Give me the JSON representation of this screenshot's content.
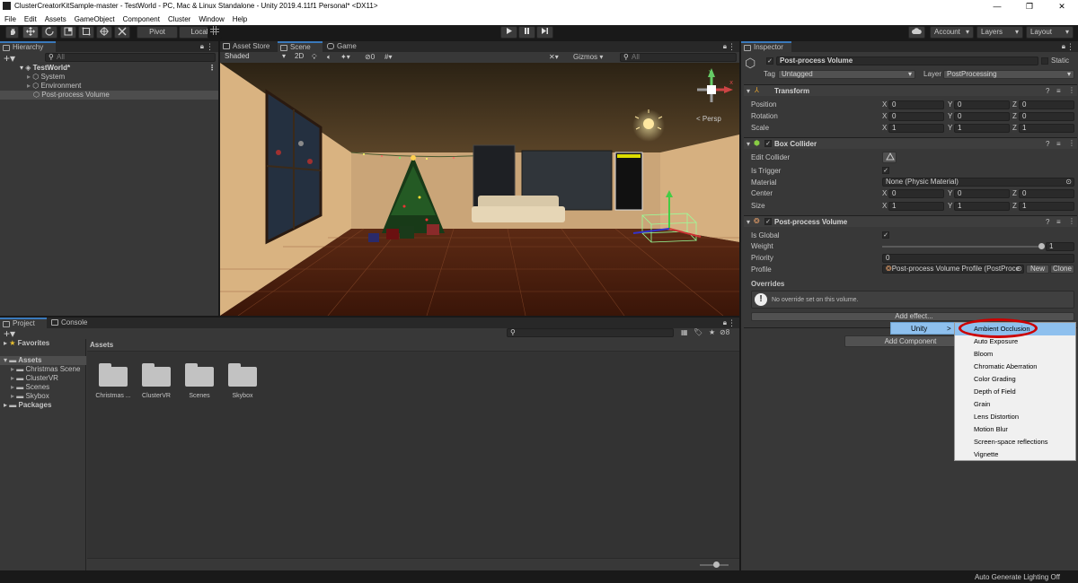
{
  "window": {
    "title": "ClusterCreatorKitSample-master - TestWorld - PC, Mac & Linux Standalone - Unity 2019.4.11f1 Personal* <DX11>",
    "minimize": "—",
    "maximize": "❐",
    "close": "✕"
  },
  "menubar": [
    "File",
    "Edit",
    "Assets",
    "GameObject",
    "Component",
    "Cluster",
    "Window",
    "Help"
  ],
  "toolbar": {
    "pivot": "Pivot",
    "local": "Local",
    "account": "Account",
    "layers": "Layers",
    "layout": "Layout"
  },
  "hierarchy": {
    "tab": "Hierarchy",
    "search_placeholder": "All",
    "scene": "TestWorld*",
    "items": [
      "System",
      "Environment",
      "Post-process Volume"
    ]
  },
  "scene_view": {
    "tabs": [
      "Asset Store",
      "Scene",
      "Game"
    ],
    "shading": "Shaded",
    "mode_2d": "2D",
    "hidden_count": "0",
    "gizmos": "Gizmos",
    "search_placeholder": "All",
    "persp": "< Persp"
  },
  "project": {
    "tabs": [
      "Project",
      "Console"
    ],
    "favorites": "Favorites",
    "assets": "Assets",
    "tree": [
      "Christmas Scene",
      "ClusterVR",
      "Scenes",
      "Skybox"
    ],
    "packages": "Packages",
    "header": "Assets",
    "hidden_count": "8",
    "folders": [
      "Christmas ...",
      "ClusterVR",
      "Scenes",
      "Skybox"
    ]
  },
  "inspector": {
    "tab": "Inspector",
    "object_name": "Post-process Volume",
    "static": "Static",
    "tag_label": "Tag",
    "tag_value": "Untagged",
    "layer_label": "Layer",
    "layer_value": "PostProcessing",
    "transform": {
      "title": "Transform",
      "rows": [
        {
          "label": "Position",
          "x": "0",
          "y": "0",
          "z": "0"
        },
        {
          "label": "Rotation",
          "x": "0",
          "y": "0",
          "z": "0"
        },
        {
          "label": "Scale",
          "x": "1",
          "y": "1",
          "z": "1"
        }
      ]
    },
    "box_collider": {
      "title": "Box Collider",
      "edit_collider": "Edit Collider",
      "is_trigger": "Is Trigger",
      "material_label": "Material",
      "material_value": "None (Physic Material)",
      "center": {
        "label": "Center",
        "x": "0",
        "y": "0",
        "z": "0"
      },
      "size": {
        "label": "Size",
        "x": "1",
        "y": "1",
        "z": "1"
      }
    },
    "ppv": {
      "title": "Post-process Volume",
      "is_global": "Is Global",
      "weight_label": "Weight",
      "weight_value": "1",
      "priority_label": "Priority",
      "priority_value": "0",
      "profile_label": "Profile",
      "profile_value": "Post-process Volume Profile (PostProce",
      "new_btn": "New",
      "clone_btn": "Clone",
      "overrides": "Overrides",
      "no_override": "No override set on this volume.",
      "add_effect": "Add effect..."
    },
    "add_component": "Add Component"
  },
  "axis": {
    "x": "X",
    "y": "Y",
    "z": "Z"
  },
  "context_menu": {
    "unity": "Unity",
    "arrow": ">",
    "items": [
      "Ambient Occlusion",
      "Auto Exposure",
      "Bloom",
      "Chromatic Aberration",
      "Color Grading",
      "Depth of Field",
      "Grain",
      "Lens Distortion",
      "Motion Blur",
      "Screen-space reflections",
      "Vignette"
    ],
    "highlight_color": "#cc0000"
  },
  "statusbar": {
    "text": "Auto Generate Lighting Off"
  }
}
